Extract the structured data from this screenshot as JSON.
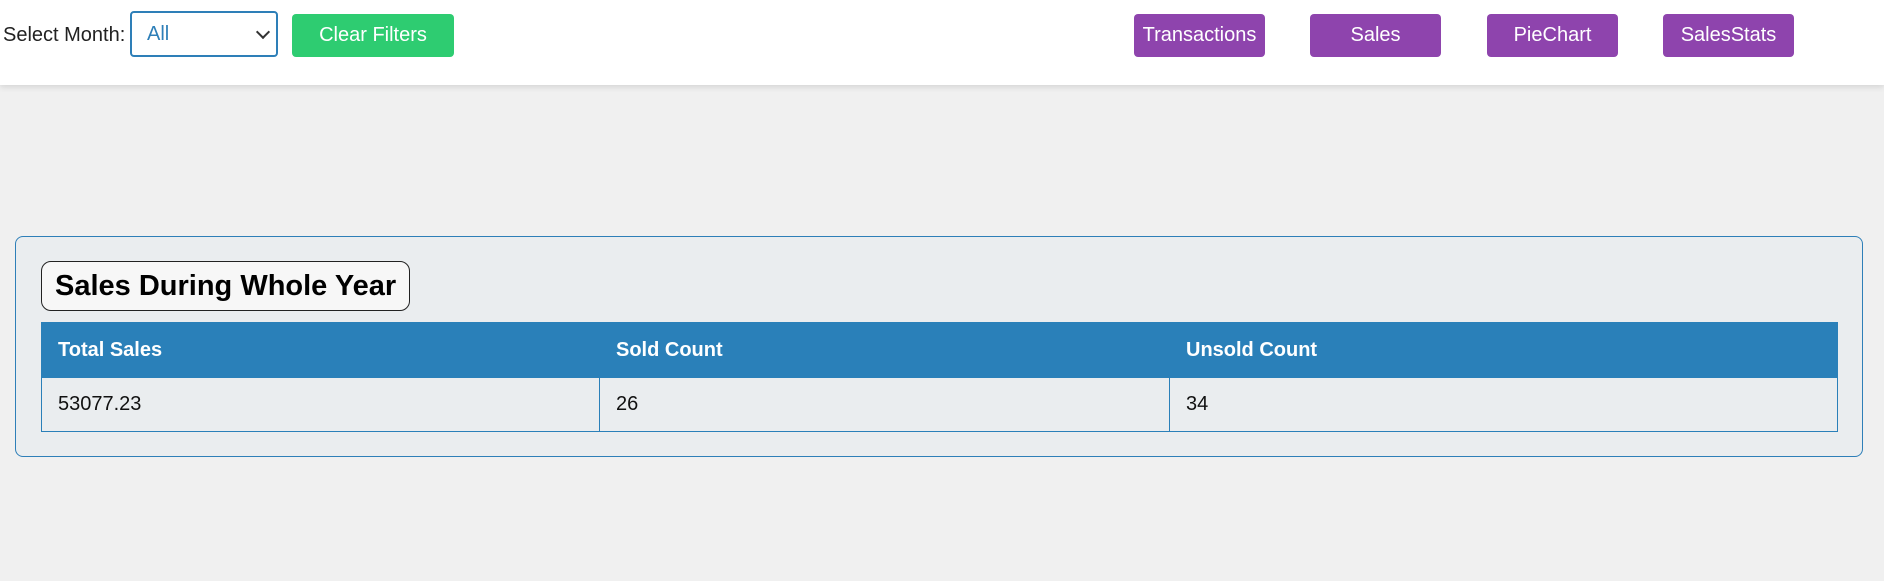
{
  "filters": {
    "month_label": "Select Month:",
    "month_selected": "All",
    "clear_label": "Clear Filters"
  },
  "nav": {
    "transactions": "Transactions",
    "sales": "Sales",
    "piechart": "PieChart",
    "salesstats": "SalesStats"
  },
  "card": {
    "title": "Sales During Whole Year",
    "headers": [
      "Total Sales",
      "Sold Count",
      "Unsold Count"
    ],
    "row": [
      "53077.23",
      "26",
      "34"
    ]
  },
  "colors": {
    "nav_button": "#8e44ad",
    "clear_button": "#2ecc71",
    "table_header": "#2a80b9",
    "select_border": "#2e7fb8"
  }
}
